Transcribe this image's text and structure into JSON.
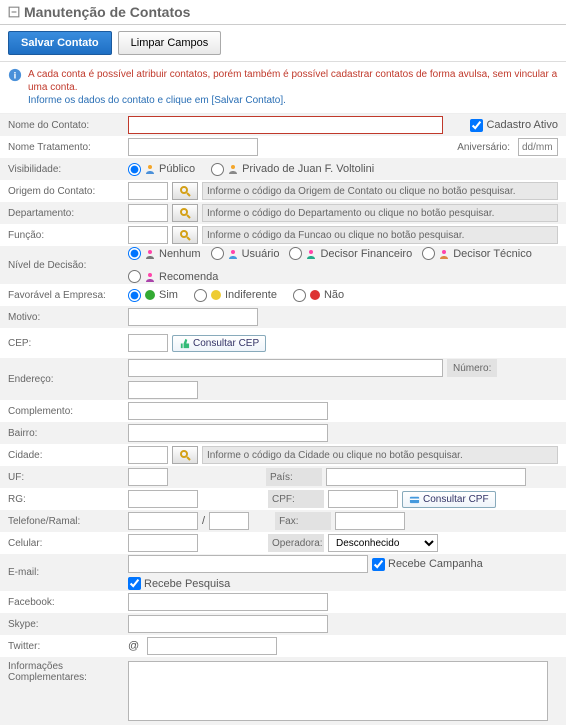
{
  "header": {
    "title": "Manutenção de Contatos"
  },
  "toolbar": {
    "save": "Salvar Contato",
    "clear": "Limpar Campos"
  },
  "info": {
    "line1": "A cada conta é possível atribuir contatos, porém também é possível cadastrar contatos de forma avulsa, sem vincular a uma conta.",
    "line2": "Informe os dados do contato e clique em [Salvar Contato]."
  },
  "labels": {
    "nome": "Nome do Contato:",
    "tratamento": "Nome Tratamento:",
    "aniversario": "Aniversário:",
    "aniv_ph": "dd/mm",
    "visibilidade": "Visibilidade:",
    "vis_publico": "Público",
    "vis_privado": "Privado de Juan F. Voltolini",
    "origem": "Origem do Contato:",
    "hint_origem": "Informe o código da Origem de Contato ou clique no botão pesquisar.",
    "departamento": "Departamento:",
    "hint_depto": "Informe o código do Departamento ou clique no botão pesquisar.",
    "funcao": "Função:",
    "hint_funcao": "Informe o código da Funcao ou clique no botão pesquisar.",
    "nivel": "Nível de Decisão:",
    "nv_nenhum": "Nenhum",
    "nv_usuario": "Usuário",
    "nv_fin": "Decisor Financeiro",
    "nv_tec": "Decisor Técnico",
    "nv_rec": "Recomenda",
    "favoravel": "Favorável a Empresa:",
    "fv_sim": "Sim",
    "fv_ind": "Indiferente",
    "fv_nao": "Não",
    "motivo": "Motivo:",
    "cep": "CEP:",
    "consultar_cep": "Consultar CEP",
    "endereco": "Endereço:",
    "numero": "Número:",
    "complemento": "Complemento:",
    "bairro": "Bairro:",
    "cidade": "Cidade:",
    "hint_cidade": "Informe o código da Cidade ou clique no botão pesquisar.",
    "uf": "UF:",
    "pais": "País:",
    "rg": "RG:",
    "cpf": "CPF:",
    "consultar_cpf": "Consultar CPF",
    "telefone": "Telefone/Ramal:",
    "slash": "/",
    "fax": "Fax:",
    "celular": "Celular:",
    "operadora": "Operadora:",
    "op_desc": "Desconhecido",
    "email": "E-mail:",
    "recebe_camp": "Recebe Campanha",
    "recebe_pesq": "Recebe Pesquisa",
    "facebook": "Facebook:",
    "skype": "Skype:",
    "twitter": "Twitter:",
    "at": "@",
    "info_comp": "Informações Complementares:",
    "cadastro_ativo": "Cadastro Ativo"
  }
}
